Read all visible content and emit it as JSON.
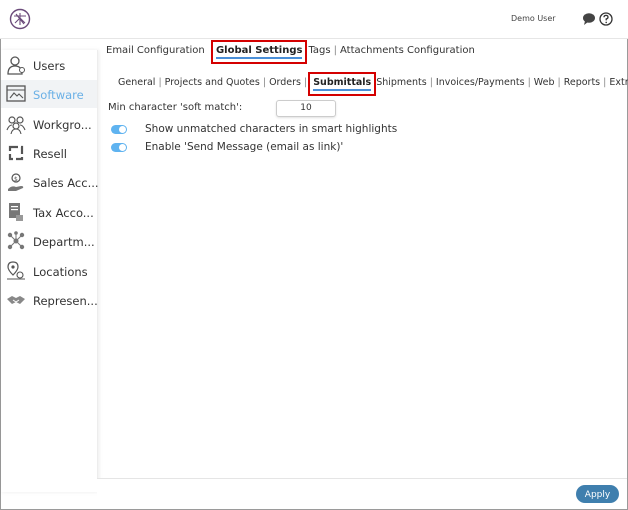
{
  "header": {
    "user_name": "Demo User",
    "icons": [
      "logo-icon",
      "chat-icon",
      "help-icon"
    ]
  },
  "sidebar": {
    "items": [
      {
        "label": "Users",
        "icon": "user-icon",
        "active": false
      },
      {
        "label": "Software",
        "icon": "software-icon",
        "active": true
      },
      {
        "label": "Workgro...",
        "icon": "workgroup-icon",
        "active": false
      },
      {
        "label": "Resell",
        "icon": "resell-icon",
        "active": false
      },
      {
        "label": "Sales Acc...",
        "icon": "sales-account-icon",
        "active": false
      },
      {
        "label": "Tax Acco...",
        "icon": "tax-account-icon",
        "active": false
      },
      {
        "label": "Departm...",
        "icon": "department-icon",
        "active": false
      },
      {
        "label": "Locations",
        "icon": "location-icon",
        "active": false
      },
      {
        "label": "Represen...",
        "icon": "representative-icon",
        "active": false
      }
    ]
  },
  "top_tabs": {
    "email": "Email Configuration",
    "global": "Global Settings",
    "tags": "Tags",
    "attachments": "Attachments Configuration",
    "active": "Global Settings"
  },
  "sub_tabs": {
    "general": "General",
    "projects": "Projects and Quotes",
    "orders": "Orders",
    "submittals": "Submittals",
    "shipments": "Shipments",
    "invoices": "Invoices/Payments",
    "web": "Web",
    "reports": "Reports",
    "extra": "Extra",
    "active": "Submittals"
  },
  "settings": {
    "soft_match_label": "Min character 'soft match':",
    "soft_match_value": "10",
    "toggle1_label": "Show unmatched characters in smart highlights",
    "toggle1_on": true,
    "toggle2_label": "Enable 'Send Message (email as link)'",
    "toggle2_on": true
  },
  "footer": {
    "apply_label": "Apply"
  },
  "colors": {
    "accent": "#5fb3f0",
    "apply_button": "#3f7fae",
    "highlight_box": "#d40000",
    "active_nav_text": "#6ab0e6"
  }
}
